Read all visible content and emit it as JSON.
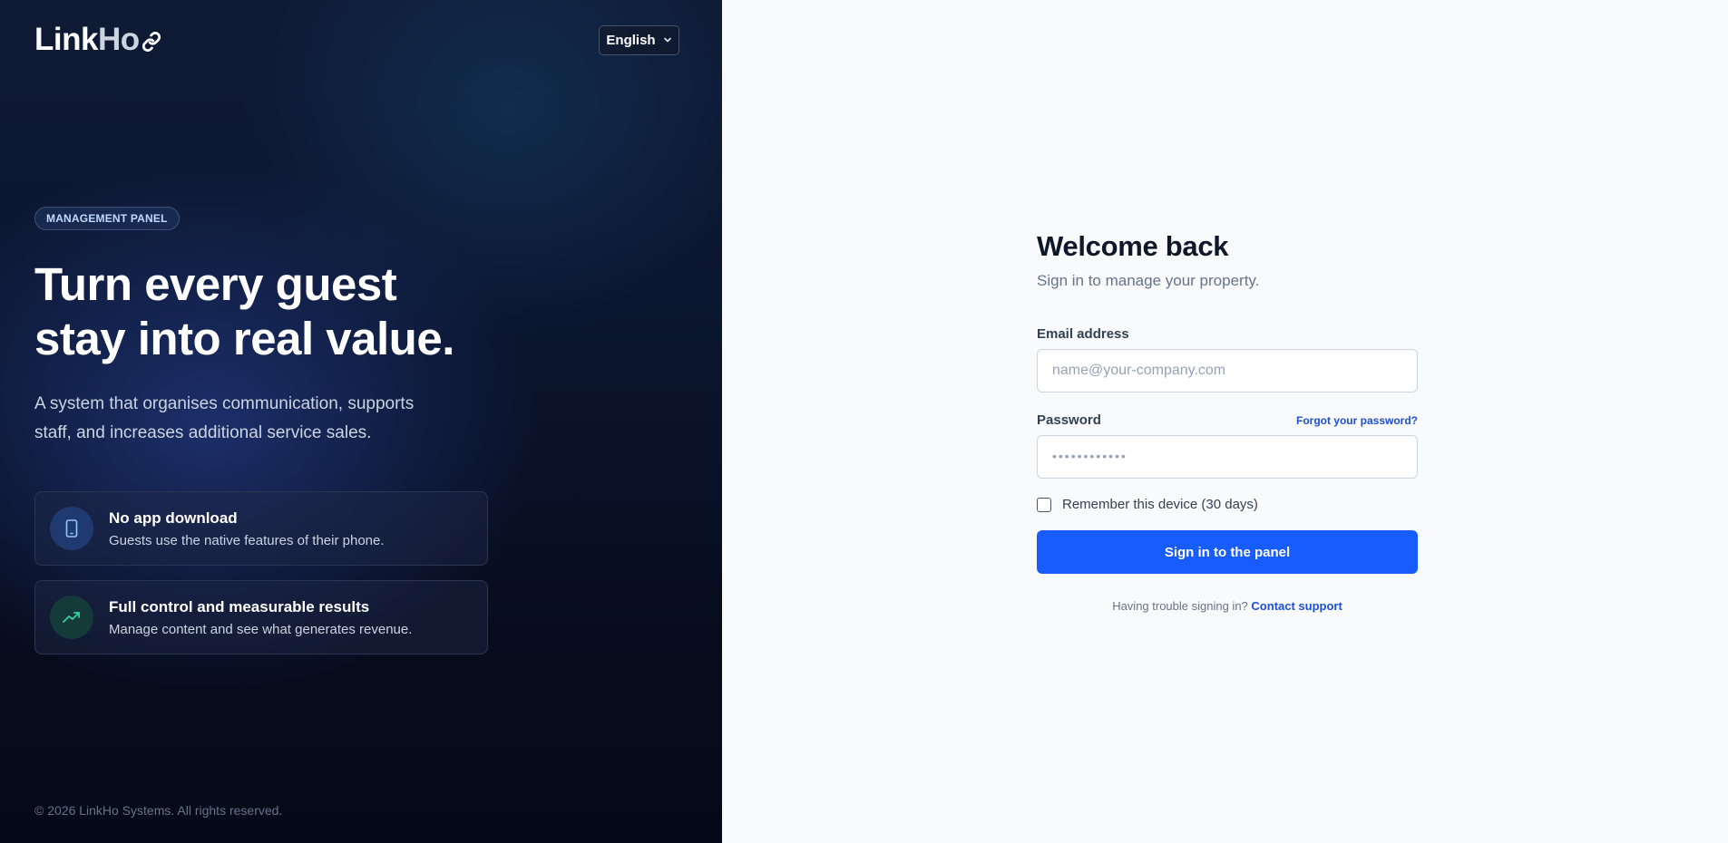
{
  "brand": {
    "logo_main": "Link",
    "logo_accent": "Ho"
  },
  "language": {
    "selected": "English"
  },
  "hero": {
    "badge": "MANAGEMENT PANEL",
    "headline_line1": "Turn every guest",
    "headline_line2": "stay into real value.",
    "subtext": "A system that organises communication, supports staff, and increases additional service sales."
  },
  "features": [
    {
      "icon": "smartphone-icon",
      "title": "No app download",
      "description": "Guests use the native features of their phone."
    },
    {
      "icon": "trending-up-icon",
      "title": "Full control and measurable results",
      "description": "Manage content and see what generates revenue."
    }
  ],
  "footer": {
    "copyright": "© 2026 LinkHo Systems. All rights reserved."
  },
  "login": {
    "title": "Welcome back",
    "subtitle": "Sign in to manage your property.",
    "email_label": "Email address",
    "email_placeholder": "name@your-company.com",
    "password_label": "Password",
    "forgot_link": "Forgot your password?",
    "password_placeholder": "••••••••••••",
    "remember_label": "Remember this device (30 days)",
    "submit_label": "Sign in to the panel",
    "trouble_text": "Having trouble signing in?",
    "support_link": "Contact support"
  },
  "colors": {
    "primary": "#175cff",
    "link": "#1d4ed8",
    "panel_dark": "#0b1630"
  }
}
